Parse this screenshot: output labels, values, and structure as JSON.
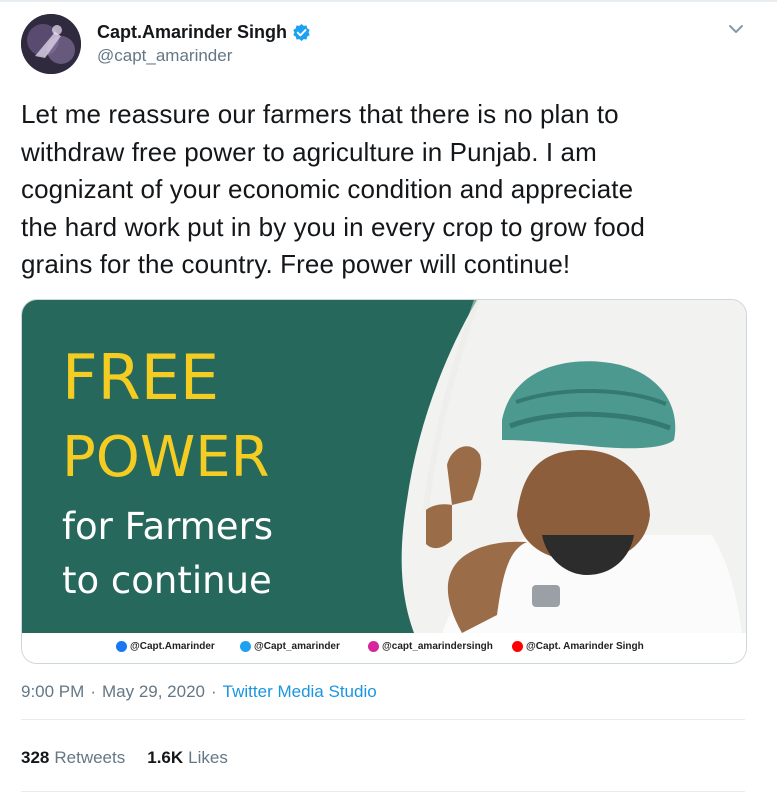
{
  "author": {
    "display_name": "Capt.Amarinder Singh",
    "handle": "@capt_amarinder",
    "verified": true
  },
  "tweet": {
    "text_lines": [
      "Let me reassure our farmers that there is no plan to",
      "withdraw free power to agriculture in Punjab. I am",
      "cognizant of your economic condition and appreciate",
      "the hard work put in by you in every crop to grow food",
      "grains for the country. Free power will continue!"
    ]
  },
  "media": {
    "headline_1": "FREE",
    "headline_2": "POWER",
    "sub_1": "for Farmers",
    "sub_2": "to continue",
    "colors": {
      "panel": "#26695c",
      "headline": "#f5cc22",
      "sub": "#ffffff"
    },
    "socials": [
      {
        "icon": "facebook-icon",
        "label": "@Capt.Amarinder",
        "color": "#1877f2"
      },
      {
        "icon": "twitter-icon",
        "label": "@Capt_amarinder",
        "color": "#1da1f2"
      },
      {
        "icon": "instagram-icon",
        "label": "@capt_amarindersingh",
        "color": "#d6249f"
      },
      {
        "icon": "youtube-icon",
        "label": "@Capt. Amarinder Singh",
        "color": "#ff0000"
      }
    ]
  },
  "meta": {
    "time": "9:00 PM",
    "date": "May 29, 2020",
    "separator": "·",
    "source": "Twitter Media Studio"
  },
  "stats": {
    "retweets_count": "328",
    "retweets_label": "Retweets",
    "likes_count": "1.6K",
    "likes_label": "Likes"
  },
  "icons": {
    "verified": "verified-badge-icon",
    "more": "chevron-down-icon"
  },
  "accent": "#1b95e0"
}
